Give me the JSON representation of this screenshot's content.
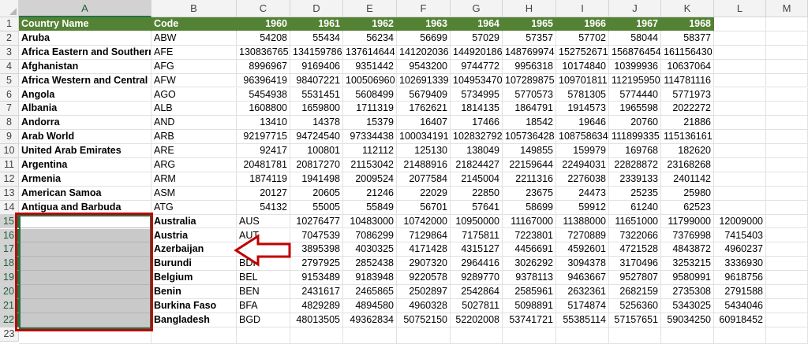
{
  "columns": [
    "A",
    "B",
    "C",
    "D",
    "E",
    "F",
    "G",
    "H",
    "I",
    "J",
    "K",
    "L",
    "M"
  ],
  "header_row": [
    "Country Name",
    "Code",
    "1960",
    "1961",
    "1962",
    "1963",
    "1964",
    "1965",
    "1966",
    "1967",
    "1968"
  ],
  "rows_main": [
    [
      "Aruba",
      "ABW",
      "54208",
      "55434",
      "56234",
      "56699",
      "57029",
      "57357",
      "57702",
      "58044",
      "58377"
    ],
    [
      "Africa Eastern and Southern",
      "AFE",
      "130836765",
      "134159786",
      "137614644",
      "141202036",
      "144920186",
      "148769974",
      "152752671",
      "156876454",
      "161156430"
    ],
    [
      "Afghanistan",
      "AFG",
      "8996967",
      "9169406",
      "9351442",
      "9543200",
      "9744772",
      "9956318",
      "10174840",
      "10399936",
      "10637064"
    ],
    [
      "Africa Western and Central",
      "AFW",
      "96396419",
      "98407221",
      "100506960",
      "102691339",
      "104953470",
      "107289875",
      "109701811",
      "112195950",
      "114781116"
    ],
    [
      "Angola",
      "AGO",
      "5454938",
      "5531451",
      "5608499",
      "5679409",
      "5734995",
      "5770573",
      "5781305",
      "5774440",
      "5771973"
    ],
    [
      "Albania",
      "ALB",
      "1608800",
      "1659800",
      "1711319",
      "1762621",
      "1814135",
      "1864791",
      "1914573",
      "1965598",
      "2022272"
    ],
    [
      "Andorra",
      "AND",
      "13410",
      "14378",
      "15379",
      "16407",
      "17466",
      "18542",
      "19646",
      "20760",
      "21886"
    ],
    [
      "Arab World",
      "ARB",
      "92197715",
      "94724540",
      "97334438",
      "100034191",
      "102832792",
      "105736428",
      "108758634",
      "111899335",
      "115136161"
    ],
    [
      "United Arab Emirates",
      "ARE",
      "92417",
      "100801",
      "112112",
      "125130",
      "138049",
      "149855",
      "159979",
      "169768",
      "182620"
    ],
    [
      "Argentina",
      "ARG",
      "20481781",
      "20817270",
      "21153042",
      "21488916",
      "21824427",
      "22159644",
      "22494031",
      "22828872",
      "23168268"
    ],
    [
      "Armenia",
      "ARM",
      "1874119",
      "1941498",
      "2009524",
      "2077584",
      "2145004",
      "2211316",
      "2276038",
      "2339133",
      "2401142"
    ],
    [
      "American Samoa",
      "ASM",
      "20127",
      "20605",
      "21246",
      "22029",
      "22850",
      "23675",
      "24473",
      "25235",
      "25980"
    ],
    [
      "Antigua and Barbuda",
      "ATG",
      "54132",
      "55005",
      "55849",
      "56701",
      "57641",
      "58699",
      "59912",
      "61240",
      "62523"
    ]
  ],
  "rows_shifted": [
    [
      "Australia",
      "AUS",
      "10276477",
      "10483000",
      "10742000",
      "10950000",
      "11167000",
      "11388000",
      "11651000",
      "11799000",
      "12009000"
    ],
    [
      "Austria",
      "AUT",
      "7047539",
      "7086299",
      "7129864",
      "7175811",
      "7223801",
      "7270889",
      "7322066",
      "7376998",
      "7415403"
    ],
    [
      "Azerbaijan",
      "AZE",
      "3895398",
      "4030325",
      "4171428",
      "4315127",
      "4456691",
      "4592601",
      "4721528",
      "4843872",
      "4960237"
    ],
    [
      "Burundi",
      "BDI",
      "2797925",
      "2852438",
      "2907320",
      "2964416",
      "3026292",
      "3094378",
      "3170496",
      "3253215",
      "3336930"
    ],
    [
      "Belgium",
      "BEL",
      "9153489",
      "9183948",
      "9220578",
      "9289770",
      "9378113",
      "9463667",
      "9527807",
      "9580991",
      "9618756"
    ],
    [
      "Benin",
      "BEN",
      "2431617",
      "2465865",
      "2502897",
      "2542864",
      "2585961",
      "2632361",
      "2682159",
      "2735308",
      "2791588"
    ],
    [
      "Burkina Faso",
      "BFA",
      "4829289",
      "4894580",
      "4960328",
      "5027811",
      "5098891",
      "5174874",
      "5256360",
      "5343025",
      "5434046"
    ],
    [
      "Bangladesh",
      "BGD",
      "48013505",
      "49362834",
      "50752150",
      "52202008",
      "53741721",
      "55385114",
      "57157651",
      "59034250",
      "60918452"
    ]
  ],
  "row_numbers": [
    "1",
    "2",
    "3",
    "4",
    "5",
    "6",
    "7",
    "8",
    "9",
    "10",
    "11",
    "12",
    "13",
    "14",
    "15",
    "16",
    "17",
    "18",
    "19",
    "20",
    "21",
    "22",
    "23"
  ],
  "selection": {
    "range": "A15:A22",
    "active_cell": "A15"
  },
  "colors": {
    "header_fill": "#548235",
    "header_text": "#ffffff",
    "selection_fill": "#c9c9c9",
    "highlight_box": "#c00000",
    "arrow": "#c00000",
    "excel_green": "#217346"
  },
  "annotation": {
    "arrow_icon": "left-arrow-icon",
    "box_icon": "highlight-box"
  }
}
